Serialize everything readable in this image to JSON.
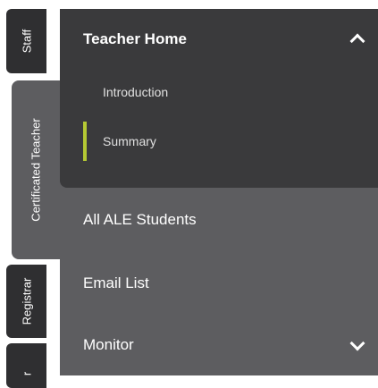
{
  "tabs": [
    {
      "label": "Staff"
    },
    {
      "label": "Certificated Teacher"
    },
    {
      "label": "Registrar"
    },
    {
      "label": "r"
    }
  ],
  "menu": {
    "expanded_section": {
      "title": "Teacher Home",
      "items": [
        {
          "label": "Introduction"
        },
        {
          "label": "Summary"
        }
      ]
    },
    "items": [
      {
        "label": "All ALE Students"
      },
      {
        "label": "Email List"
      },
      {
        "label": "Monitor"
      }
    ]
  },
  "colors": {
    "tab_bg": "#2f2f31",
    "tab_active_bg": "#5d5d60",
    "expanded_bg": "#3a3a3c",
    "panel_bg": "#5d5d60",
    "active_indicator": "#b5c934"
  },
  "icons": {
    "collapse": "chevron-up-icon",
    "expand": "chevron-down-icon"
  }
}
